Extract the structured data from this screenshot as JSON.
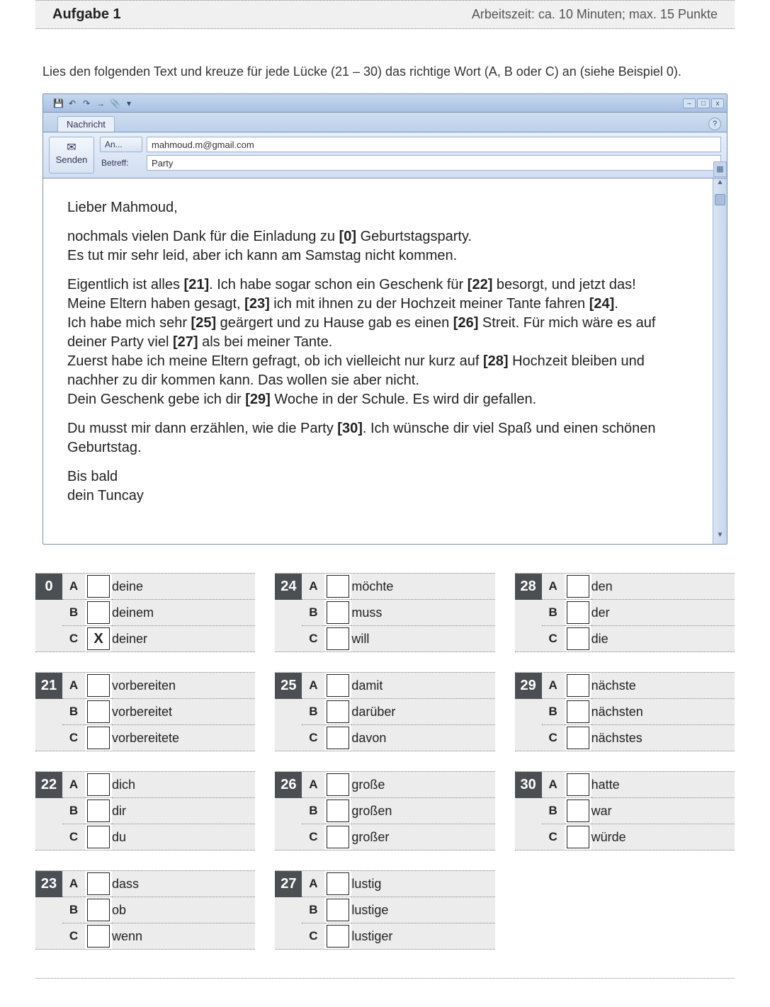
{
  "header": {
    "title": "Aufgabe 1",
    "info": "Arbeitszeit: ca. 10 Minuten; max. 15 Punkte"
  },
  "instruction": "Lies den folgenden Text und kreuze für jede Lücke (21 – 30) das richtige Wort (A, B oder C) an (siehe Beispiel 0).",
  "email": {
    "tab": "Nachricht",
    "send_label": "Senden",
    "to_label": "An...",
    "to_value": "mahmoud.m@gmail.com",
    "subject_label": "Betreff:",
    "subject_value": "Party",
    "greeting": "Lieber Mahmoud,",
    "p1a": "nochmals vielen Dank für die Einladung zu ",
    "p1b": " Geburtstagsparty.",
    "p1c": "Es tut mir sehr leid, aber ich kann am Samstag nicht kommen.",
    "p2a": "Eigentlich ist alles ",
    "p2b": ". Ich habe sogar schon ein Geschenk für ",
    "p2c": " besorgt, und jetzt das!",
    "p2d": "Meine Eltern haben gesagt, ",
    "p2e": " ich mit ihnen zu der Hochzeit meiner Tante fahren ",
    "p2f": ".",
    "p2g": "Ich habe mich sehr ",
    "p2h": " geärgert und zu Hause gab es einen ",
    "p2i": " Streit. Für mich wäre es auf deiner Party viel ",
    "p2j": " als bei meiner Tante.",
    "p2k": "Zuerst habe ich meine Eltern gefragt, ob ich vielleicht nur kurz auf ",
    "p2l": " Hochzeit bleiben und nachher zu dir kommen kann. Das wollen sie aber nicht.",
    "p2m": "Dein Geschenk gebe ich dir ",
    "p2n": " Woche in der Schule. Es wird dir gefallen.",
    "p3a": "Du musst mir dann erzählen, wie die Party ",
    "p3b": ". Ich wünsche dir viel Spaß und einen schönen Geburtstag.",
    "closing1": "Bis bald",
    "closing2": "dein Tuncay"
  },
  "questions": [
    {
      "num": "0",
      "opts": [
        {
          "l": "A",
          "t": "deine",
          "x": ""
        },
        {
          "l": "B",
          "t": "deinem",
          "x": ""
        },
        {
          "l": "C",
          "t": "deiner",
          "x": "X"
        }
      ]
    },
    {
      "num": "21",
      "opts": [
        {
          "l": "A",
          "t": "vorbereiten",
          "x": ""
        },
        {
          "l": "B",
          "t": "vorbereitet",
          "x": ""
        },
        {
          "l": "C",
          "t": "vorbereitete",
          "x": ""
        }
      ]
    },
    {
      "num": "22",
      "opts": [
        {
          "l": "A",
          "t": "dich",
          "x": ""
        },
        {
          "l": "B",
          "t": "dir",
          "x": ""
        },
        {
          "l": "C",
          "t": "du",
          "x": ""
        }
      ]
    },
    {
      "num": "23",
      "opts": [
        {
          "l": "A",
          "t": "dass",
          "x": ""
        },
        {
          "l": "B",
          "t": "ob",
          "x": ""
        },
        {
          "l": "C",
          "t": "wenn",
          "x": ""
        }
      ]
    },
    {
      "num": "24",
      "opts": [
        {
          "l": "A",
          "t": "möchte",
          "x": ""
        },
        {
          "l": "B",
          "t": "muss",
          "x": ""
        },
        {
          "l": "C",
          "t": "will",
          "x": ""
        }
      ]
    },
    {
      "num": "25",
      "opts": [
        {
          "l": "A",
          "t": "damit",
          "x": ""
        },
        {
          "l": "B",
          "t": "darüber",
          "x": ""
        },
        {
          "l": "C",
          "t": "davon",
          "x": ""
        }
      ]
    },
    {
      "num": "26",
      "opts": [
        {
          "l": "A",
          "t": "große",
          "x": ""
        },
        {
          "l": "B",
          "t": "großen",
          "x": ""
        },
        {
          "l": "C",
          "t": "großer",
          "x": ""
        }
      ]
    },
    {
      "num": "27",
      "opts": [
        {
          "l": "A",
          "t": "lustig",
          "x": ""
        },
        {
          "l": "B",
          "t": "lustige",
          "x": ""
        },
        {
          "l": "C",
          "t": "lustiger",
          "x": ""
        }
      ]
    },
    {
      "num": "28",
      "opts": [
        {
          "l": "A",
          "t": "den",
          "x": ""
        },
        {
          "l": "B",
          "t": "der",
          "x": ""
        },
        {
          "l": "C",
          "t": "die",
          "x": ""
        }
      ]
    },
    {
      "num": "29",
      "opts": [
        {
          "l": "A",
          "t": "nächste",
          "x": ""
        },
        {
          "l": "B",
          "t": "nächsten",
          "x": ""
        },
        {
          "l": "C",
          "t": "nächstes",
          "x": ""
        }
      ]
    },
    {
      "num": "30",
      "opts": [
        {
          "l": "A",
          "t": "hatte",
          "x": ""
        },
        {
          "l": "B",
          "t": "war",
          "x": ""
        },
        {
          "l": "C",
          "t": "würde",
          "x": ""
        }
      ]
    }
  ],
  "layout": [
    [
      "0",
      "24",
      "28"
    ],
    [
      "21",
      "25",
      "29"
    ],
    [
      "22",
      "26",
      "30"
    ],
    [
      "23",
      "27",
      null
    ]
  ]
}
